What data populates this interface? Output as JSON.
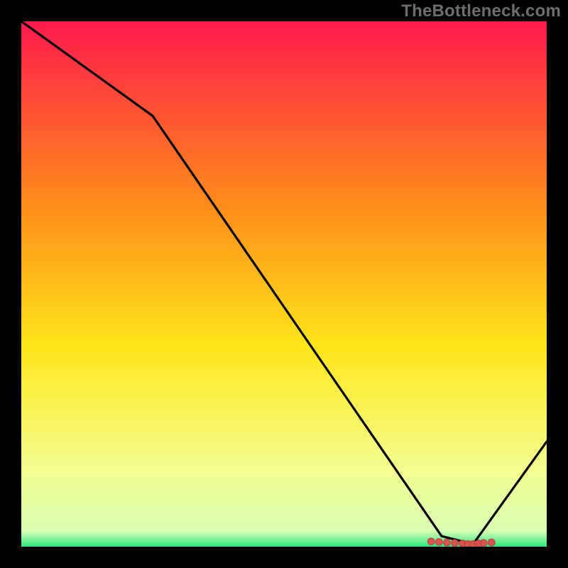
{
  "watermark": "TheBottleneck.com",
  "colors": {
    "bg": "#000000",
    "watermark": "#6e6e6e",
    "line": "#000000",
    "dot_fill": "#d9534f",
    "dot_stroke": "#b84440",
    "grad_top": "#ff1a4d",
    "grad_mid1": "#ff8c1a",
    "grad_mid2": "#ffe61a",
    "grad_low": "#f4ff8f",
    "grad_bottom": "#2be57e"
  },
  "chart_data": {
    "type": "line",
    "title": "",
    "xlabel": "",
    "ylabel": "",
    "xlim": [
      0,
      100
    ],
    "ylim": [
      0,
      100
    ],
    "series": [
      {
        "name": "curve",
        "x": [
          0,
          25,
          80,
          86,
          100
        ],
        "values": [
          100,
          82,
          2,
          0.5,
          20
        ]
      }
    ],
    "markers": {
      "name": "bottom-cluster",
      "x": [
        78,
        79.5,
        81,
        82.5,
        84,
        85,
        86,
        87,
        88,
        89.5
      ],
      "values": [
        1.0,
        0.9,
        0.8,
        0.7,
        0.6,
        0.5,
        0.5,
        0.6,
        0.7,
        0.8
      ]
    }
  }
}
